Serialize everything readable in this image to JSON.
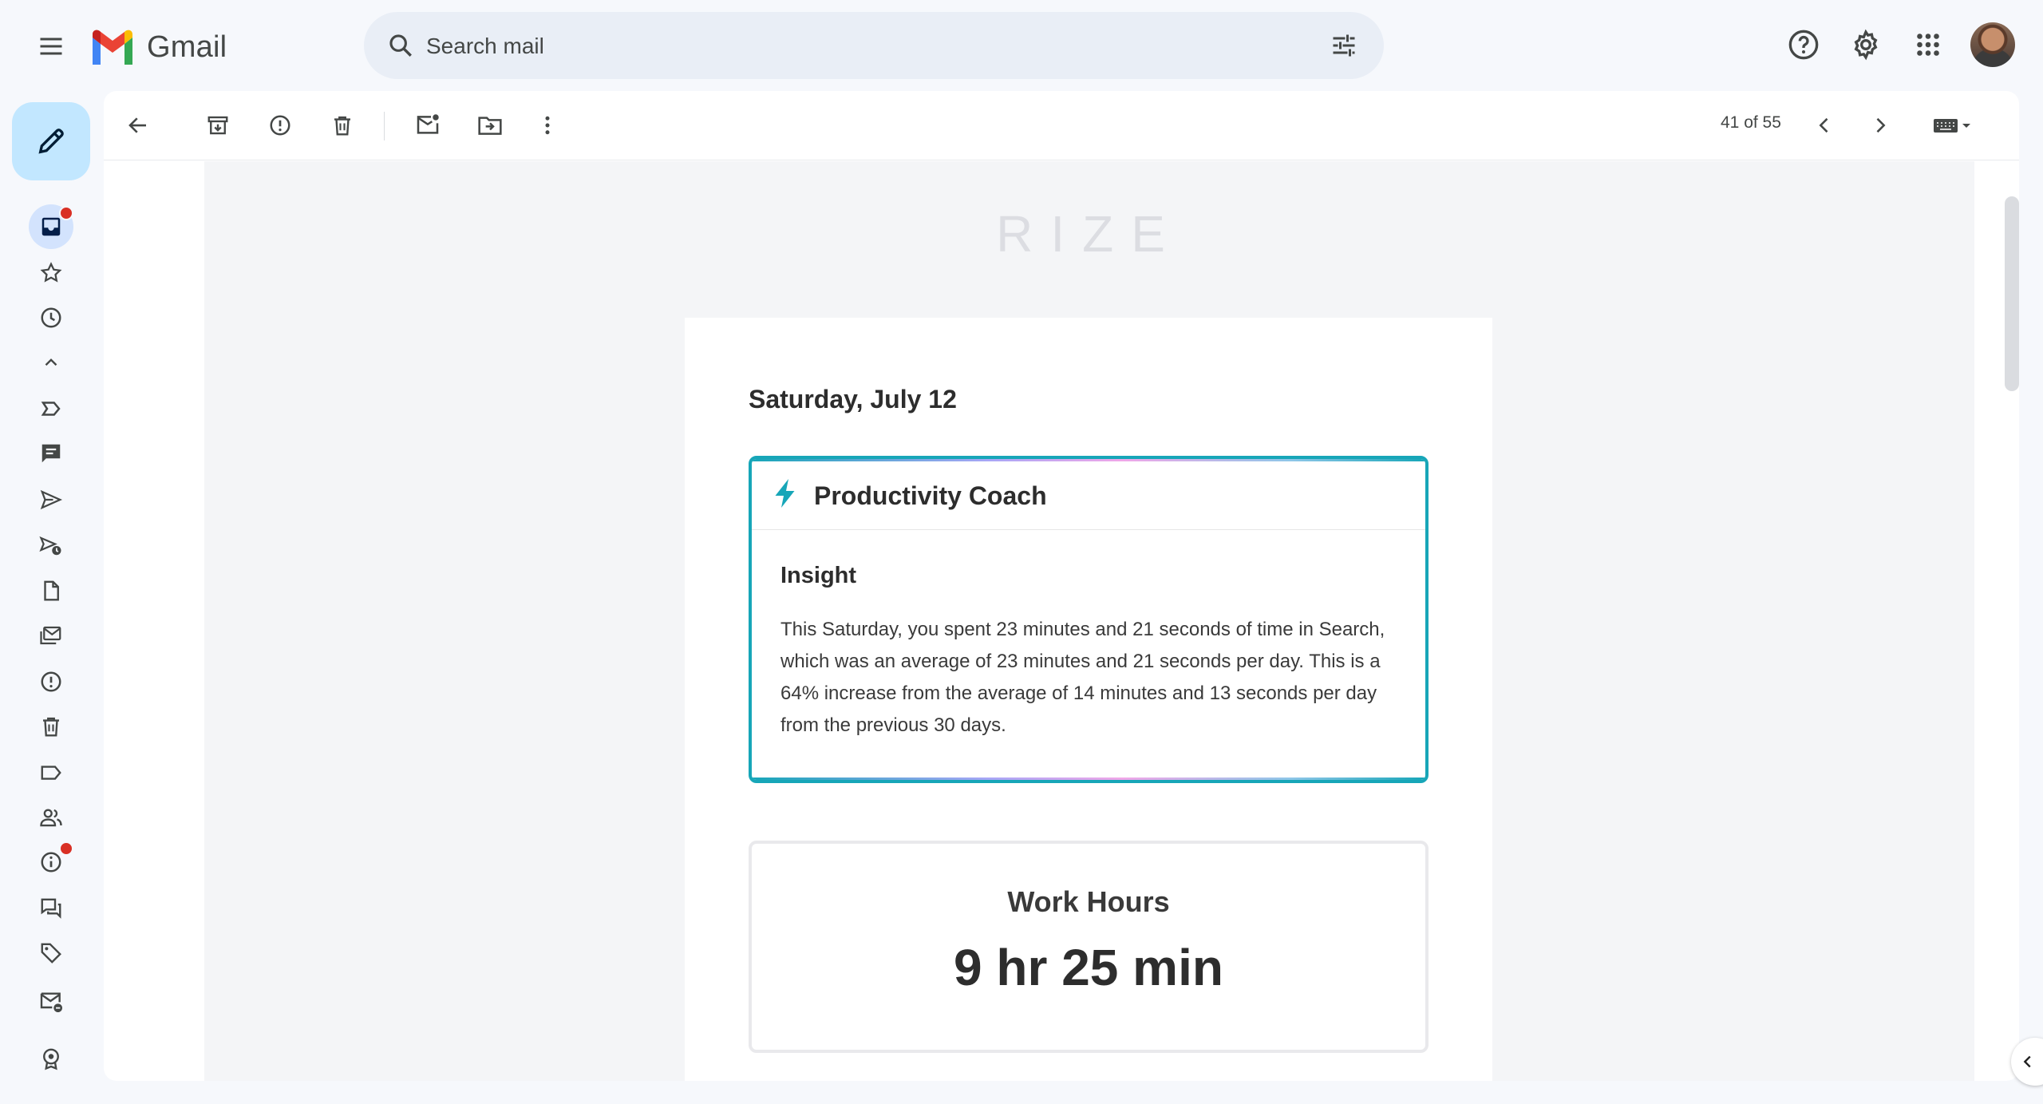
{
  "header": {
    "app_name": "Gmail",
    "search_placeholder": "Search mail"
  },
  "toolbar": {
    "counter": "41 of 55"
  },
  "email": {
    "brand": "RIZE",
    "date": "Saturday, July 12",
    "coach": {
      "title": "Productivity Coach",
      "insight_title": "Insight",
      "insight_text": "This Saturday, you spent 23 minutes and 21 seconds of time in Search, which was an average of 23 minutes and 21 seconds per day. This is a 64% increase from the average of 14 minutes and 13 seconds per day from the previous 30 days."
    },
    "work_hours": {
      "title": "Work Hours",
      "value": "9 hr 25 min"
    }
  },
  "colors": {
    "accent": "#17a6b8",
    "compose_bg": "#c2e7ff",
    "notification_dot": "#d93025"
  },
  "icons": {
    "rail": [
      "inbox-icon",
      "star-icon",
      "clock-icon",
      "chevron-up-icon",
      "label-important-icon",
      "chat-icon",
      "send-icon",
      "scheduled-send-icon",
      "draft-icon",
      "all-mail-icon",
      "spam-icon",
      "trash-icon",
      "label-icon",
      "people-icon",
      "info-icon",
      "forum-icon",
      "tag-icon",
      "mail-badge-icon",
      "award-icon"
    ]
  }
}
